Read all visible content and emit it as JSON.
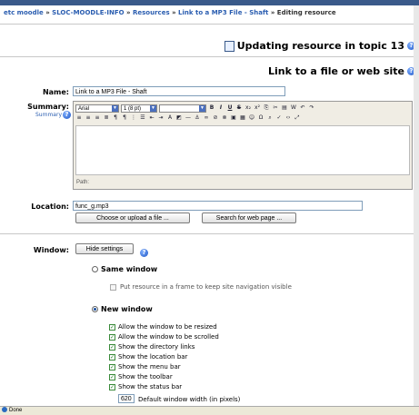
{
  "breadcrumb": {
    "items": [
      "etc moodle",
      "SLOC-MOODLE-INFO",
      "Resources",
      "Link to a MP3 File - Shaft",
      "Editing resource"
    ],
    "sep": "»"
  },
  "header": {
    "updating": "Updating resource in topic 13",
    "section": "Link to a file or web site"
  },
  "name": {
    "label": "Name:",
    "value": "Link to a MP3 File - Shaft"
  },
  "summary": {
    "label": "Summary:",
    "sublabel": "Summary",
    "font_family": "Arial",
    "font_size": "1 (8 pt)",
    "path_label": "Path:"
  },
  "location": {
    "label": "Location:",
    "value": "func_g.mp3",
    "choose_button": "Choose or upload a file ...",
    "search_button": "Search for web page ..."
  },
  "window": {
    "label": "Window:",
    "hide_button": "Hide settings",
    "same_window": "Same window",
    "frame_option": "Put resource in a frame to keep site navigation visible",
    "new_window": "New window",
    "options": [
      "Allow the window to be resized",
      "Allow the window to be scrolled",
      "Show the directory links",
      "Show the location bar",
      "Show the menu bar",
      "Show the toolbar",
      "Show the status bar"
    ],
    "width_value": "620",
    "width_label": "Default window width (in pixels)"
  },
  "status": {
    "text": "Done"
  },
  "colors": {
    "accent": "#2a5db0",
    "toolbar": "#f0ede4",
    "status_bar": "#ece9d8"
  }
}
